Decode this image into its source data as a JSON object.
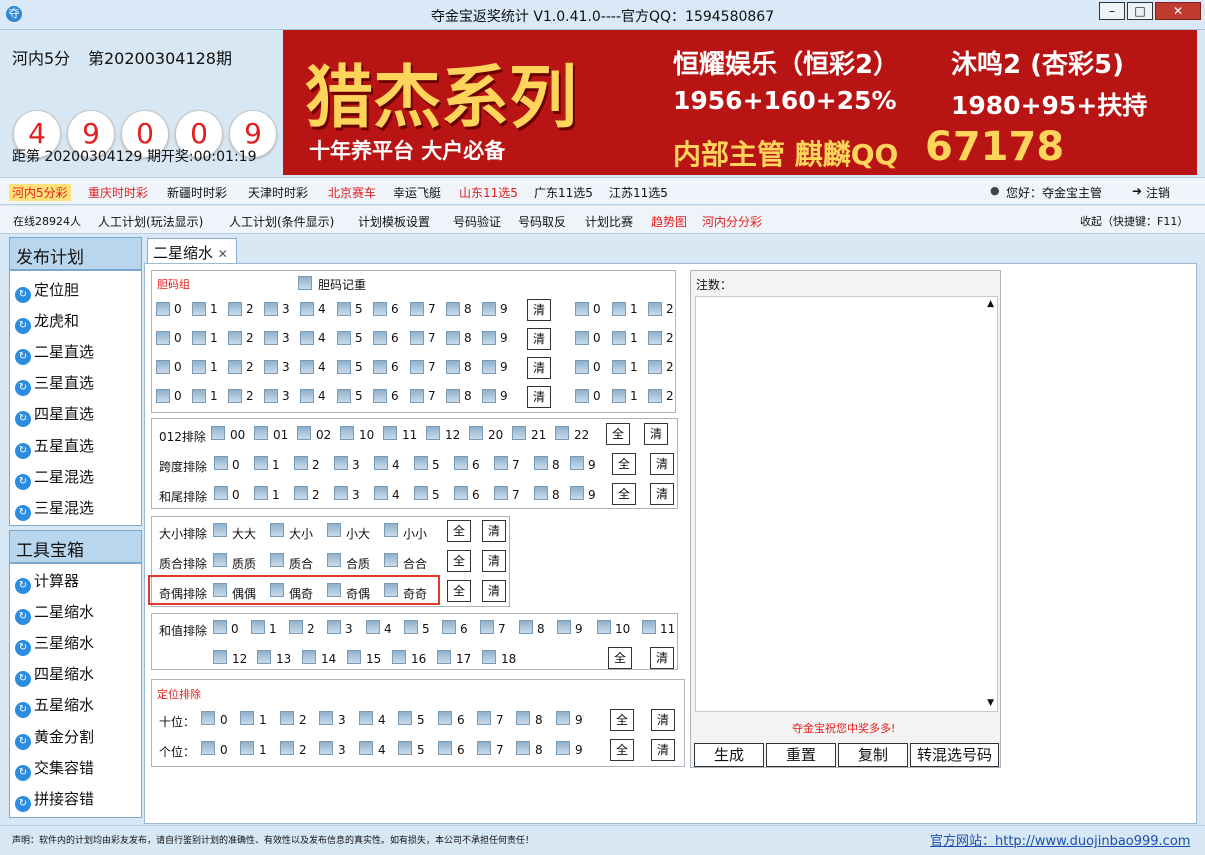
{
  "window": {
    "title": "夺金宝返奖统计  V1.0.41.0----官方QQ：1594580867",
    "minimize": "–",
    "maximize": "□",
    "close": "✕",
    "app_icon": "夺"
  },
  "draw": {
    "lottery": "河内5分",
    "issue": "第20200304128期",
    "balls": [
      "4",
      "9",
      "0",
      "0",
      "9"
    ],
    "next": "距第 20200304129 期开奖:00:01:19"
  },
  "banner": {
    "main_title": "猎杰系列",
    "tagline": "十年养平台  大户必备",
    "ad1": "恒耀娱乐（恒彩2）",
    "ad1_num": "1956+160+25%",
    "ad2": "沐鸣2 (杏彩5)",
    "ad2_num": "1980+95+扶持",
    "contact": "内部主管 麒麟QQ",
    "qq": "67178"
  },
  "lottery_nav": {
    "items": [
      "河内5分彩",
      "重庆时时彩",
      "新疆时时彩",
      "天津时时彩",
      "北京赛车",
      "幸运飞艇",
      "山东11选5",
      "广东11选5",
      "江苏11选5"
    ],
    "greeting": "您好：夺金宝主管",
    "logout": "注销"
  },
  "tools_nav": {
    "online": "在线28924人",
    "items": [
      "人工计划(玩法显示)",
      "人工计划(条件显示)",
      "计划模板设置",
      "号码验证",
      "号码取反",
      "计划比赛",
      "趋势图",
      "河内分分彩"
    ],
    "collapse": "收起（快捷键：F11）"
  },
  "sidebar": {
    "plan_title": "发布计划",
    "plan_items": [
      "定位胆",
      "龙虎和",
      "二星直选",
      "三星直选",
      "四星直选",
      "五星直选",
      "二星混选",
      "三星混选"
    ],
    "tools_title": "工具宝箱",
    "tool_items": [
      "计算器",
      "二星缩水",
      "三星缩水",
      "四星缩水",
      "五星缩水",
      "黄金分割",
      "交集容错",
      "拼接容错"
    ]
  },
  "tab": {
    "label": "二星缩水",
    "close": "✕"
  },
  "dan": {
    "title": "胆码组",
    "dup": "胆码记重",
    "digits": [
      "0",
      "1",
      "2",
      "3",
      "4",
      "5",
      "6",
      "7",
      "8",
      "9"
    ],
    "right_digits": [
      "0",
      "1",
      "2"
    ]
  },
  "rows": {
    "r012": "012排除",
    "r012_opts": [
      "00",
      "01",
      "02",
      "10",
      "11",
      "12",
      "20",
      "21",
      "22"
    ],
    "span": "跨度排除",
    "tail": "和尾排除",
    "size": "大小排除",
    "size_opts": [
      "大大",
      "大小",
      "小大",
      "小小"
    ],
    "prime": "质合排除",
    "prime_opts": [
      "质质",
      "质合",
      "合质",
      "合合"
    ],
    "parity": "奇偶排除",
    "parity_opts": [
      "偶偶",
      "偶奇",
      "奇偶",
      "奇奇"
    ],
    "sum": "和值排除",
    "sum_opts": [
      "0",
      "1",
      "2",
      "3",
      "4",
      "5",
      "6",
      "7",
      "8",
      "9",
      "10",
      "11",
      "12",
      "13",
      "14",
      "15",
      "16",
      "17",
      "18"
    ]
  },
  "pos": {
    "title": "定位排除",
    "tens": "十位：",
    "units": "个位："
  },
  "buttons": {
    "all": "全",
    "clear": "清"
  },
  "notes": {
    "label": "注数：",
    "bless": "夺金宝祝您中奖多多!",
    "gen": "生成",
    "reset": "重置",
    "copy": "复制",
    "to_mixed": "转混选号码"
  },
  "footer": {
    "disclaimer": "声明：软件内的计划均由彩友发布，请自行鉴别计划的准确性、有效性以及发布信息的真实性。如有损失，本公司不承担任何责任！",
    "site": "官方网站：http://www.duojinbao999.com"
  },
  "colors": {
    "accent_red": "#e41e1e",
    "banner_red": "#b81413",
    "gold": "#ffd45a",
    "link": "#1a4fb3"
  }
}
